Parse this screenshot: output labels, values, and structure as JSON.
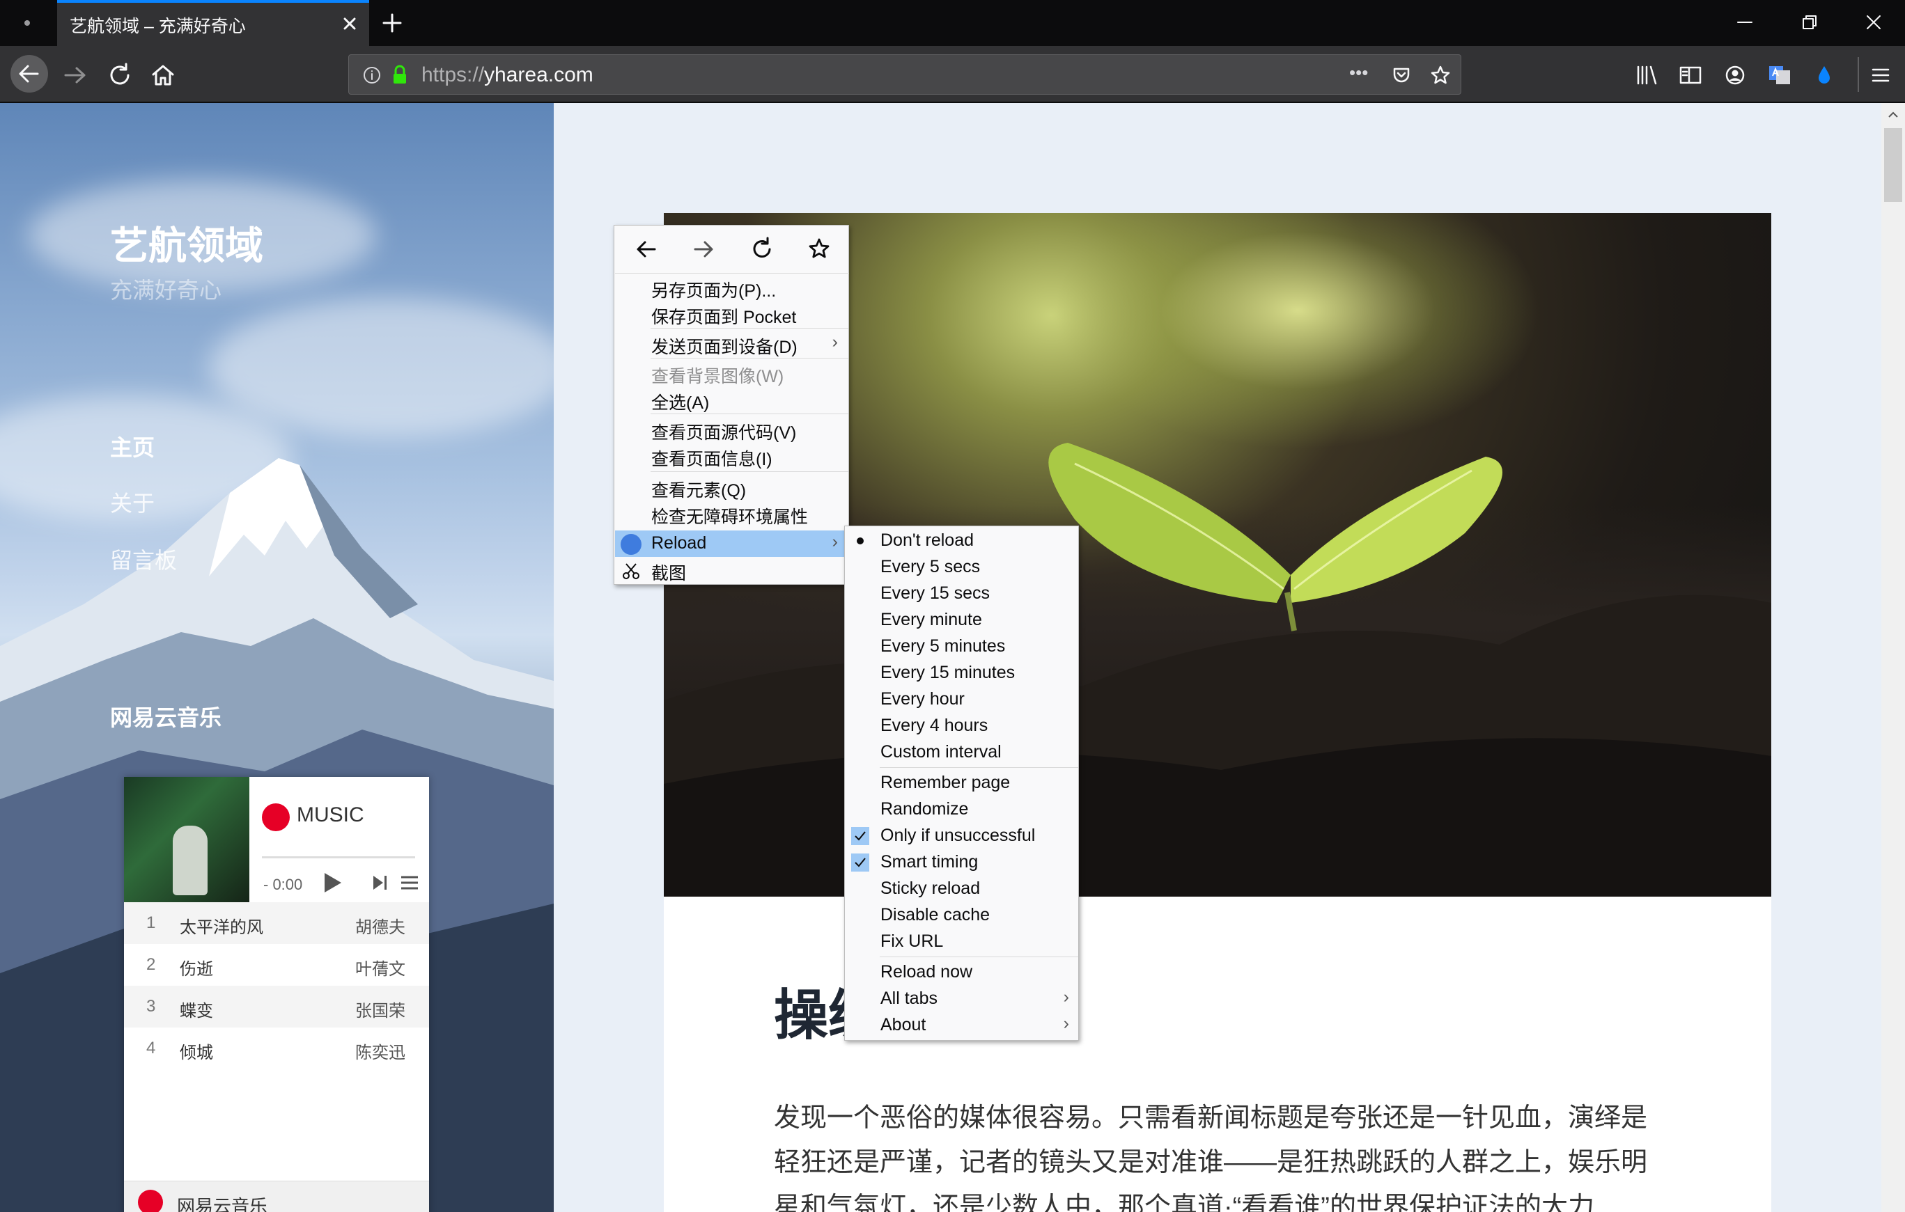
{
  "browser": {
    "tab_title": "艺航领域 – 充满好奇心",
    "url_prefix": "https://",
    "url_domain": "yharea.com",
    "url_more": "•••"
  },
  "site": {
    "title": "艺航领域",
    "subtitle": "充满好奇心",
    "nav": [
      "主页",
      "关于",
      "留言板"
    ],
    "music_heading": "网易云音乐"
  },
  "player": {
    "title": "MUSIC",
    "time": "- 0:00",
    "tracks": [
      {
        "num": "1",
        "name": "太平洋的风",
        "artist": "胡德夫"
      },
      {
        "num": "2",
        "name": "伤逝",
        "artist": "叶蒨文"
      },
      {
        "num": "3",
        "name": "蝶变",
        "artist": "张国荣"
      },
      {
        "num": "4",
        "name": "倾城",
        "artist": "陈奕迅"
      }
    ],
    "footer": "网易云音乐"
  },
  "article": {
    "title": "操纵",
    "body": "发现一个恶俗的媒体很容易。只需看新闻标题是夸张还是一针见血，演绎是轻狂还是严谨，记者的镜头又是对准谁——是狂热跳跃的人群之上，娱乐明星和气氛灯，还是少数人中，那个真道·“看看谁”的世界保护证法的大力"
  },
  "context_menu": {
    "items": [
      {
        "label": "另存页面为(P)...",
        "arrow": ""
      },
      {
        "label": "保存页面到 Pocket",
        "arrow": ""
      },
      {
        "label": "发送页面到设备(D)",
        "arrow": "›"
      },
      {
        "label": "查看背景图像(W)",
        "arrow": ""
      },
      {
        "label": "全选(A)",
        "arrow": ""
      },
      {
        "label": "查看页面源代码(V)",
        "arrow": ""
      },
      {
        "label": "查看页面信息(I)",
        "arrow": ""
      },
      {
        "label": "查看元素(Q)",
        "arrow": ""
      },
      {
        "label": "检查无障碍环境属性",
        "arrow": ""
      },
      {
        "label": "Reload",
        "arrow": "›"
      },
      {
        "label": "截图",
        "arrow": ""
      }
    ]
  },
  "reload_submenu": {
    "items": [
      {
        "label": "Don't reload",
        "arrow": ""
      },
      {
        "label": "Every 5 secs",
        "arrow": ""
      },
      {
        "label": "Every 15 secs",
        "arrow": ""
      },
      {
        "label": "Every minute",
        "arrow": ""
      },
      {
        "label": "Every 5 minutes",
        "arrow": ""
      },
      {
        "label": "Every 15 minutes",
        "arrow": ""
      },
      {
        "label": "Every hour",
        "arrow": ""
      },
      {
        "label": "Every 4 hours",
        "arrow": ""
      },
      {
        "label": "Custom interval",
        "arrow": ""
      },
      {
        "label": "Remember page",
        "arrow": ""
      },
      {
        "label": "Randomize",
        "arrow": ""
      },
      {
        "label": "Only if unsuccessful",
        "arrow": ""
      },
      {
        "label": "Smart timing",
        "arrow": ""
      },
      {
        "label": "Sticky reload",
        "arrow": ""
      },
      {
        "label": "Disable cache",
        "arrow": ""
      },
      {
        "label": "Fix URL",
        "arrow": ""
      },
      {
        "label": "Reload now",
        "arrow": ""
      },
      {
        "label": "All tabs",
        "arrow": "›"
      },
      {
        "label": "About",
        "arrow": "›"
      }
    ]
  },
  "colors": {
    "accent": "#0a84ff",
    "menu_highlight": "#9ec9f5"
  }
}
